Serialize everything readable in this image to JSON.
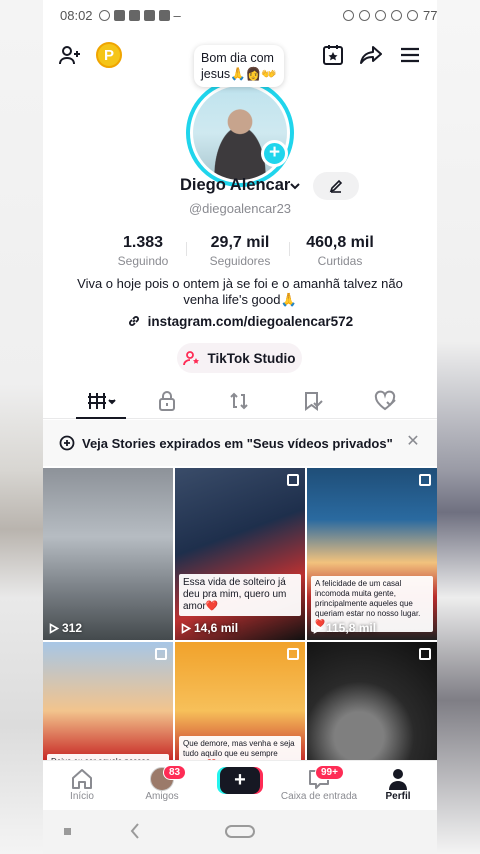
{
  "status_bar": {
    "time": "08:02",
    "battery": "77%"
  },
  "profile": {
    "bubble_text": "Bom dia com jesus🙏👩👐",
    "name": "Diego Alencar",
    "handle": "@diegoalencar23",
    "bio": "Viva o hoje pois o ontem jà se foi e o amanhã talvez não venha life's good🙏",
    "link": "instagram.com/diegoalencar572",
    "studio_button": "TikTok Studio"
  },
  "stats": [
    {
      "value": "1.383",
      "label": "Seguindo"
    },
    {
      "value": "29,7 mil",
      "label": "Seguidores"
    },
    {
      "value": "460,8 mil",
      "label": "Curtidas"
    }
  ],
  "stories_banner": "Veja Stories expirados em \"Seus vídeos privados\"",
  "videos": [
    {
      "views": "312",
      "caption": ""
    },
    {
      "views": "14,6 mil",
      "caption": "Essa vida de solteiro já deu pra mim, quero um amor❤️"
    },
    {
      "views": "115,8 mil",
      "caption": "A felicidade de um casal incomoda muita gente, principalmente aqueles que queriam estar no nosso lugar.❤️"
    },
    {
      "views": "",
      "caption": "Deixa eu ser aquela pessoa que vai te dar"
    },
    {
      "views": "",
      "caption": "Que demore, mas venha e seja tudo aquilo que eu sempre sonhei❤️"
    },
    {
      "views": "",
      "caption": ""
    }
  ],
  "nav": {
    "home": "Início",
    "friends": "Amigos",
    "friends_badge": "83",
    "inbox": "Caixa de entrada",
    "inbox_badge": "99+",
    "profile": "Perfil"
  },
  "colors": {
    "accent": "#fe2c55",
    "ring": "#20d5ec"
  }
}
